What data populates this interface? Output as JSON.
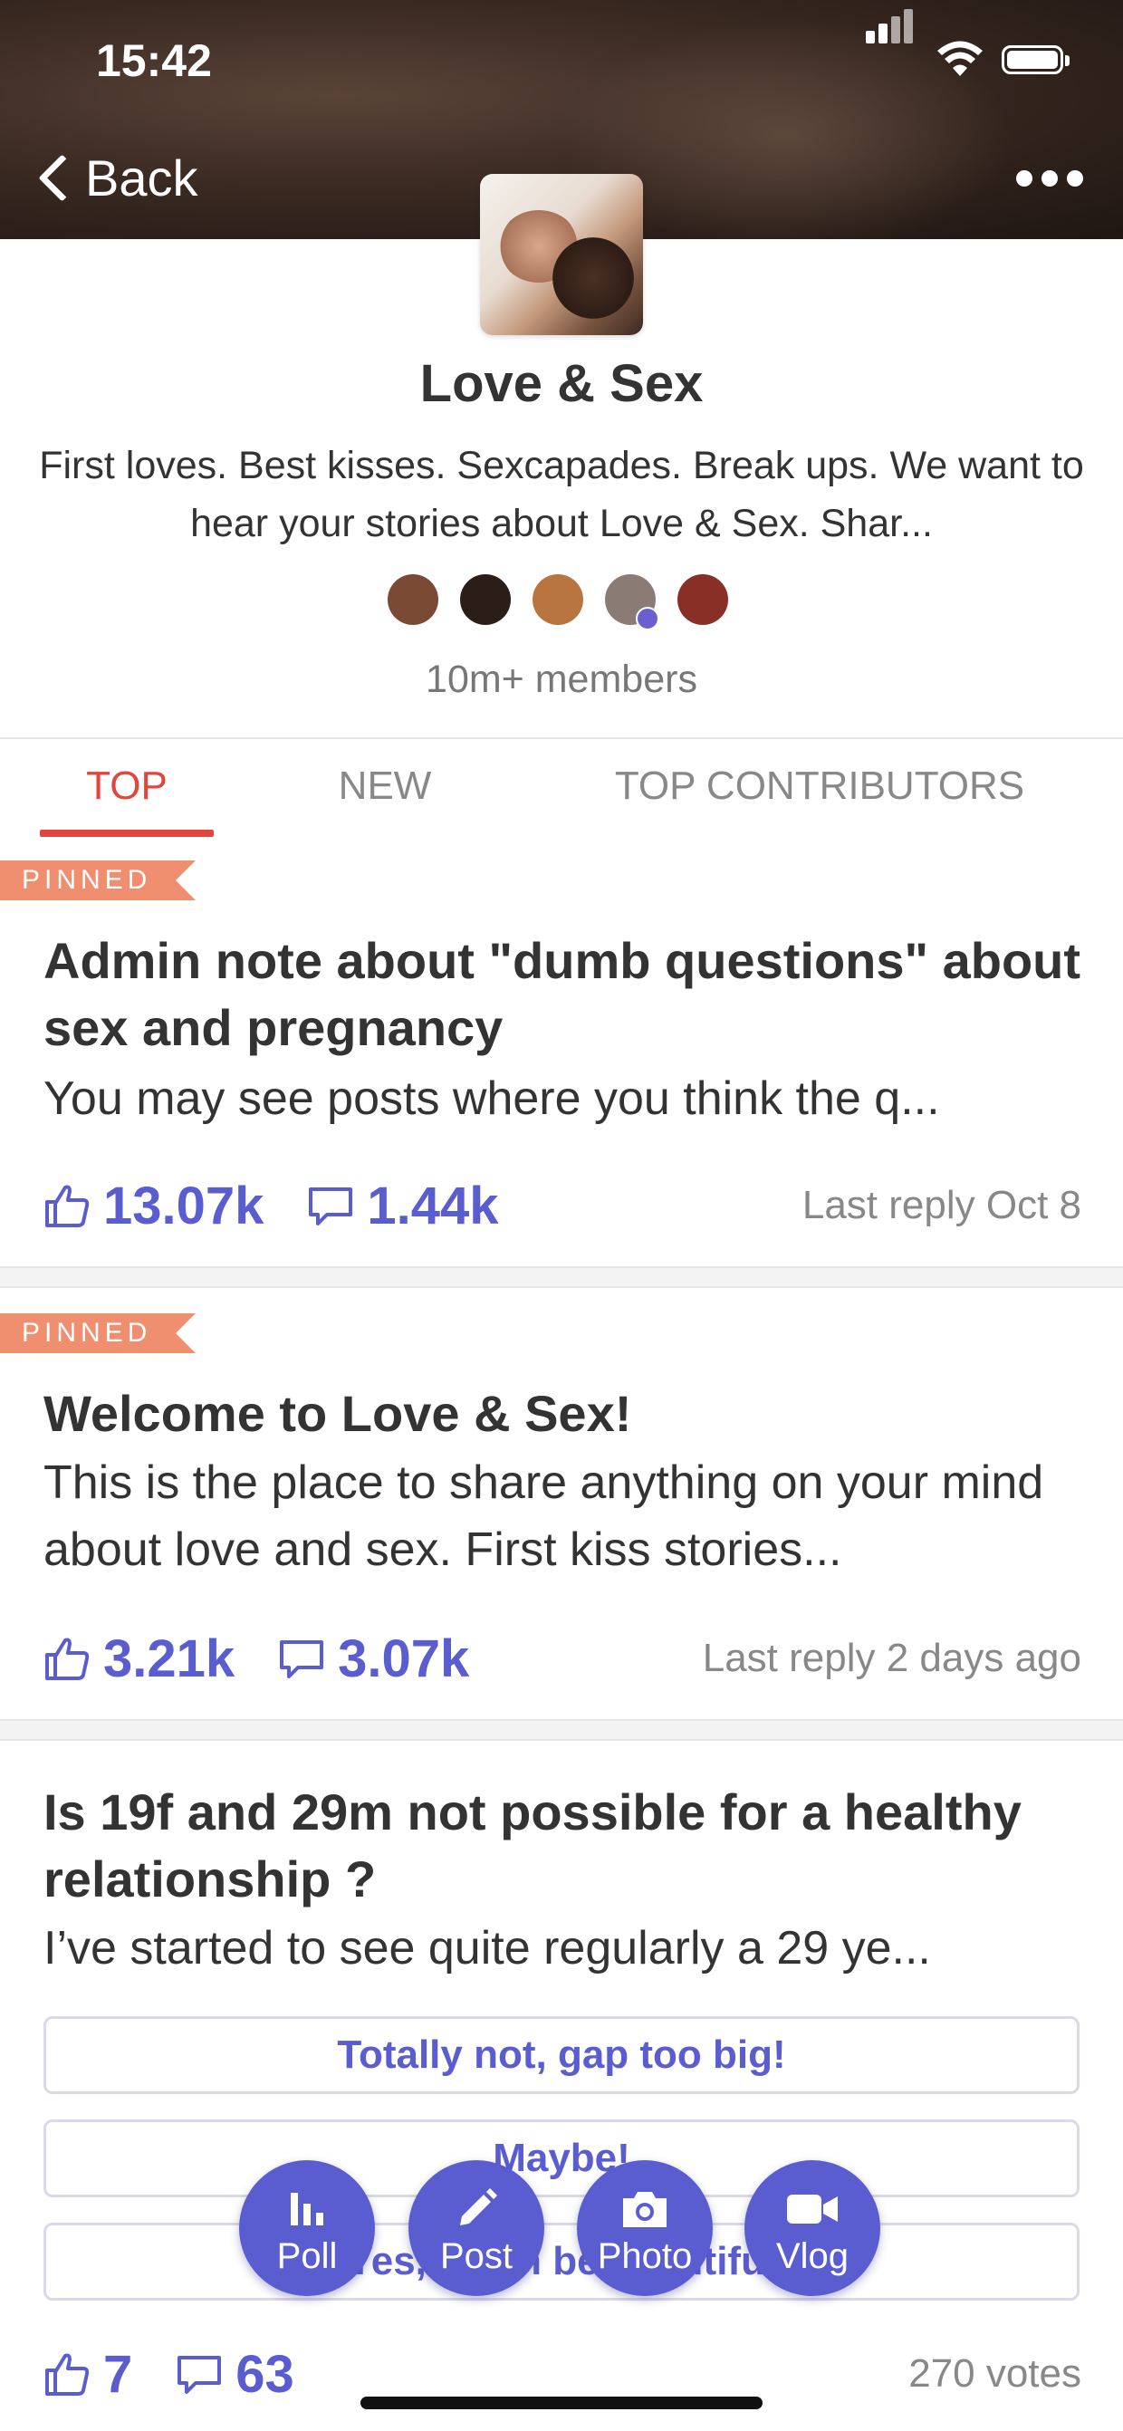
{
  "status_bar": {
    "time": "15:42"
  },
  "nav": {
    "back_label": "Back"
  },
  "group": {
    "title": "Love & Sex",
    "description": "First loves. Best kisses. Sexcapades. Break ups. We want to hear your stories about Love & Sex. Shar...",
    "members_count": "10m+ members",
    "member_avatar_colors": [
      "#7a4a34",
      "#2b1d18",
      "#b9753f",
      "#8a7c74",
      "#8a2f26"
    ]
  },
  "tabs": [
    {
      "label": "TOP",
      "active": true
    },
    {
      "label": "NEW",
      "active": false
    },
    {
      "label": "TOP CONTRIBUTORS",
      "active": false
    }
  ],
  "posts": [
    {
      "pinned_label": "PINNED",
      "title": "Admin note about \"dumb questions\" about sex and pregnancy",
      "body": "You may see posts where you think the q...",
      "likes": "13.07k",
      "comments": "1.44k",
      "last_reply": "Last reply Oct 8"
    },
    {
      "pinned_label": "PINNED",
      "title": "Welcome to Love & Sex!",
      "body": "This is the place to share anything on your mind about love and sex. First kiss stories...",
      "likes": "3.21k",
      "comments": "3.07k",
      "last_reply": "Last reply 2 days ago"
    },
    {
      "title": "Is 19f and 29m not possible for a healthy relationship ?",
      "body": "I’ve started to see quite regularly a 29 ye...",
      "poll_options": [
        "Totally not, gap too big!",
        "Maybe!",
        "Yes, it can be beautiful"
      ],
      "likes": "7",
      "comments": "63",
      "votes": "270 votes"
    }
  ],
  "fabs": [
    {
      "label": "Poll",
      "icon": "bar-chart-icon"
    },
    {
      "label": "Post",
      "icon": "pencil-icon"
    },
    {
      "label": "Photo",
      "icon": "camera-icon"
    },
    {
      "label": "Vlog",
      "icon": "video-camera-icon"
    }
  ],
  "colors": {
    "accent": "#5a5dd0",
    "tab_active": "#e2453d",
    "pinned_badge": "#ef8f6f"
  }
}
